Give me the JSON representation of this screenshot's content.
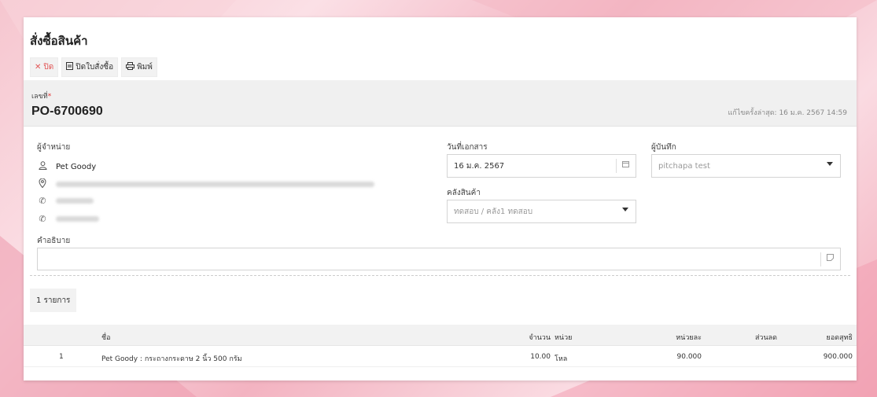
{
  "page": {
    "title": "สั่งซื้อสินค้า"
  },
  "toolbar": {
    "close_label": "ปิด",
    "close_order_label": "ปิดใบสั่งซื้อ",
    "print_label": "พิมพ์"
  },
  "document": {
    "number_label": "เลขที่",
    "required_mark": "*",
    "number": "PO-6700690",
    "last_edited": "แก้ไขครั้งล่าสุด: 16 ม.ค. 2567 14:59"
  },
  "supplier": {
    "label": "ผู้จำหน่าย",
    "name": "Pet Goody"
  },
  "doc_date": {
    "label": "วันที่เอกสาร",
    "value": "16 ม.ค. 2567"
  },
  "recorder": {
    "label": "ผู้บันทึก",
    "value": "pitchapa test"
  },
  "warehouse": {
    "label": "คลังสินค้า",
    "value": "ทดสอบ / คลัง1 ทดสอบ"
  },
  "description": {
    "label": "คำอธิบาย",
    "value": ""
  },
  "items_count": "1 รายการ",
  "table": {
    "headers": {
      "name": "ชื่อ",
      "qty": "จำนวน",
      "unit": "หน่วย",
      "unit_price": "หน่วยละ",
      "discount": "ส่วนลด",
      "net": "ยอดสุทธิ"
    },
    "rows": [
      {
        "no": "1",
        "name": "Pet Goody : กระถางกระดาษ 2 นิ้ว 500 กรัม",
        "qty": "10.00",
        "unit": "โหล",
        "unit_price": "90.000",
        "discount": "",
        "net": "900.000"
      }
    ]
  },
  "colors": {
    "accent_red": "#e25555",
    "band_gray": "#f0f0f0"
  }
}
